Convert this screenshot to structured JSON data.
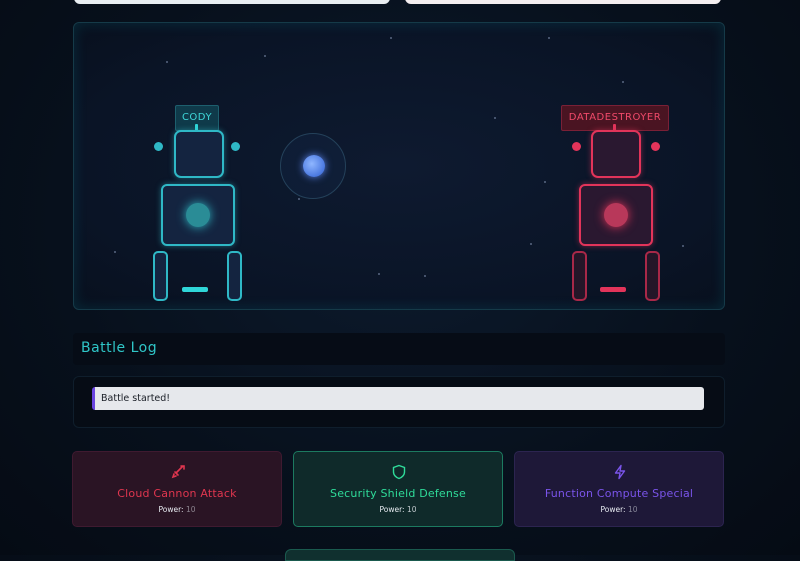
{
  "arena": {
    "player": {
      "name": "CODY",
      "color": "#2fb8c6"
    },
    "enemy": {
      "name": "DATADESTROYER",
      "color": "#e2345a"
    }
  },
  "battle_log": {
    "title": "Battle Log",
    "entries": [
      "Battle started!"
    ]
  },
  "actions": [
    {
      "label": "Cloud Cannon Attack",
      "power_label": "Power:",
      "power_value": "10",
      "icon": "sword-icon",
      "color": "#e0364f"
    },
    {
      "label": "Security Shield Defense",
      "power_label": "Power:",
      "power_value": "10",
      "icon": "shield-icon",
      "color": "#2fdc9a"
    },
    {
      "label": "Function Compute Special",
      "power_label": "Power:",
      "power_value": "10",
      "icon": "lightning-icon",
      "color": "#7a54ea"
    }
  ]
}
